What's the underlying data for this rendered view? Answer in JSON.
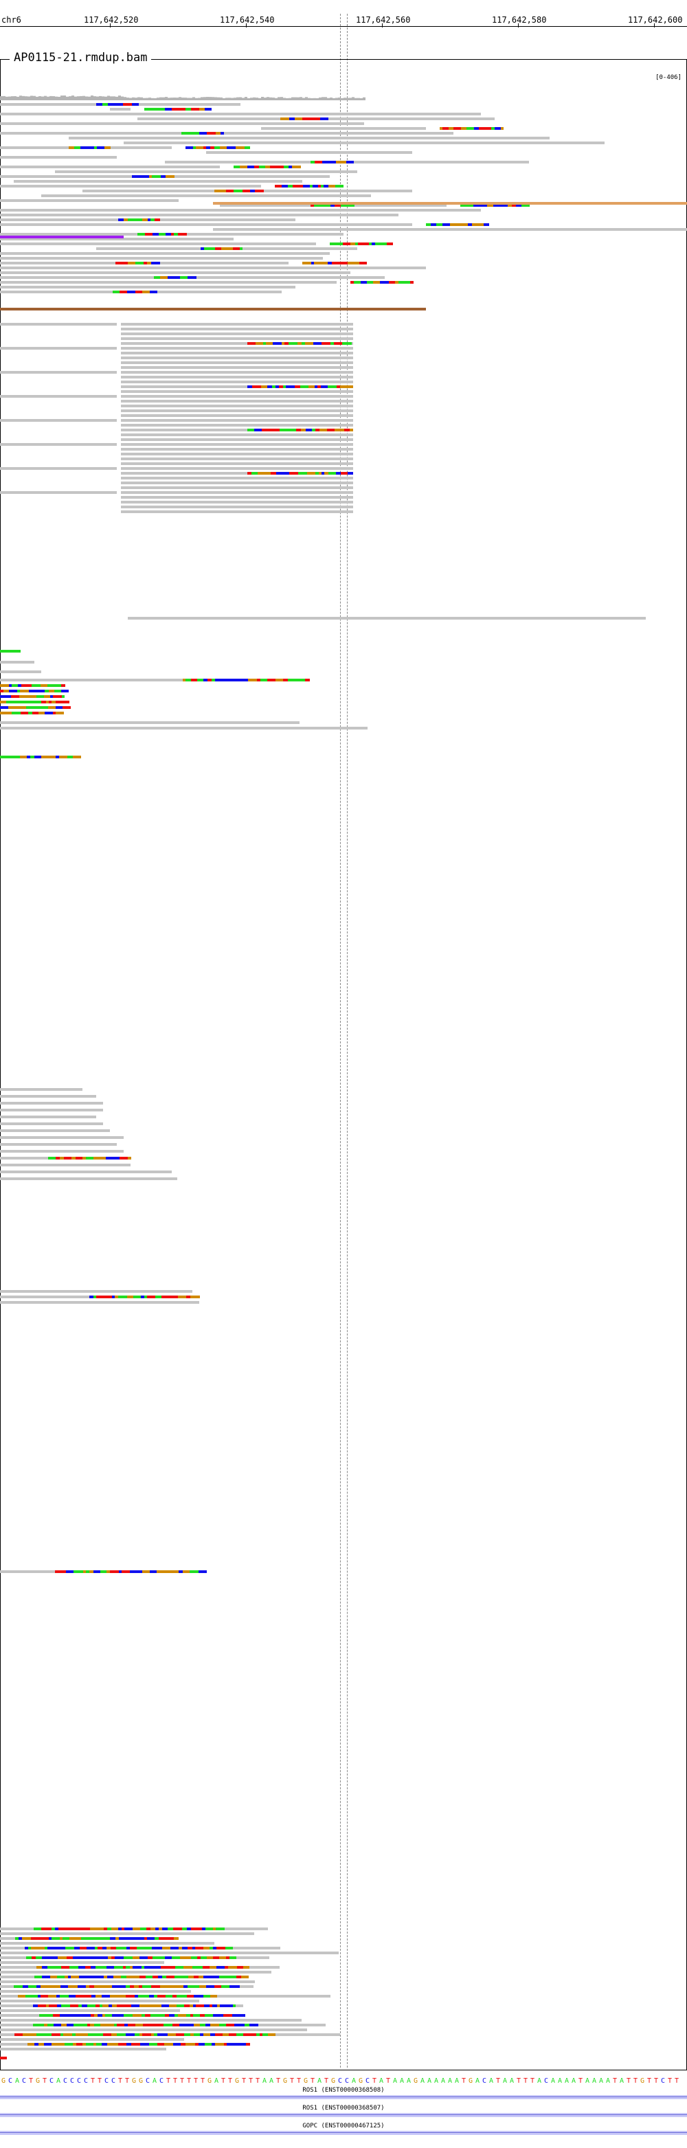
{
  "ruler": {
    "chromosome": "chr6",
    "ticks": [
      "117,642,520",
      "117,642,540",
      "117,642,560",
      "117,642,580",
      "117,642,600"
    ]
  },
  "track": {
    "name": "AP0115-21.rmdup.bam",
    "data_range": "[0-406]"
  },
  "sequence": "GCACTGTCACCCCTTCCTTGGCACTTTTTTGATTGTTTAATGTTGTATGCCAGCTATAAAGAAAAAATGACATAATTTACAAAATAAAATATTGTTCTT",
  "genes": [
    {
      "label": "ROS1 (ENST00000368508)"
    },
    {
      "label": "ROS1 (ENST00000368507)"
    },
    {
      "label": "GOPC (ENST00000467125)"
    }
  ],
  "colors": {
    "read": "#c4c4c4",
    "coverage": "#b4b4b4",
    "A": "#22dd22",
    "C": "#1010ee",
    "G": "#d18a00",
    "T": "#ee1010",
    "insertion": "#a020f0",
    "discordant_orange": "#e0a060",
    "discordant_brown": "#a06030"
  }
}
